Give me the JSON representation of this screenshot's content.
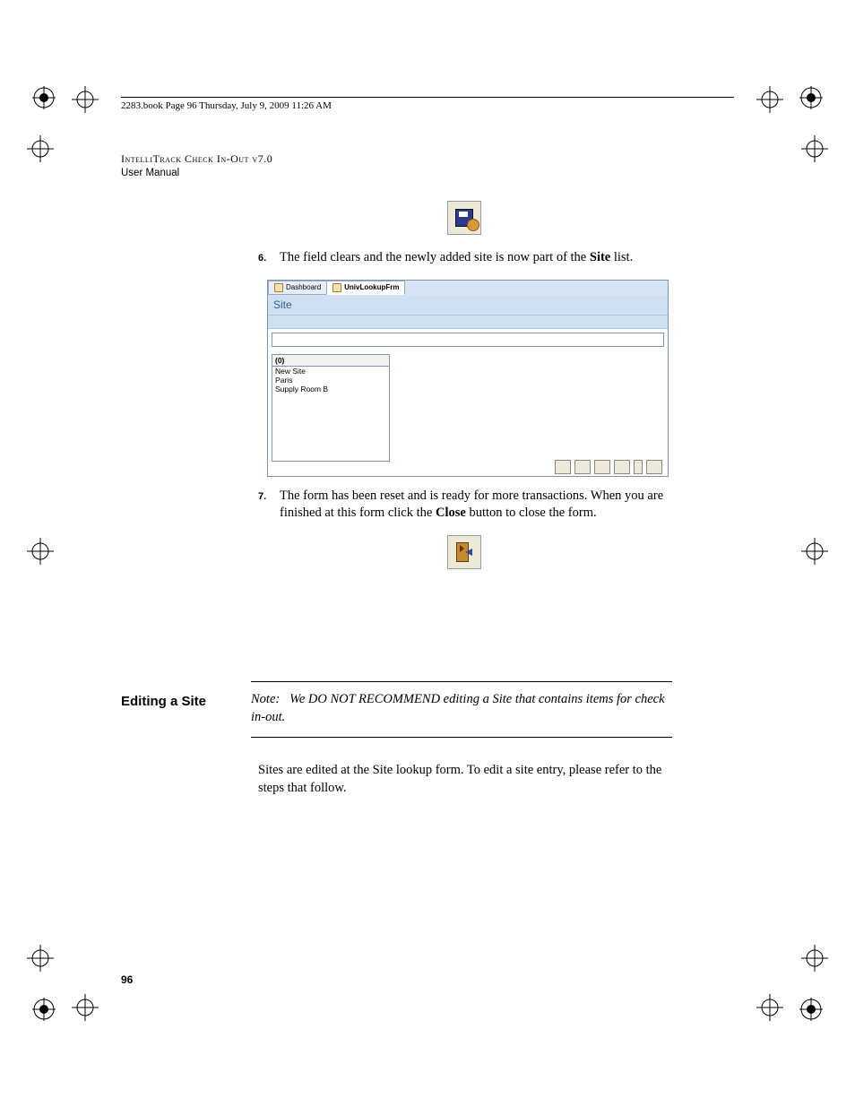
{
  "header": {
    "crop_text": "2283.book  Page 96  Thursday, July 9, 2009  11:26 AM",
    "title_line1": "IntelliTrack Check In-Out v7.0",
    "title_line2": "User Manual"
  },
  "steps": {
    "s6": {
      "num": "6.",
      "text_a": "The field clears and the newly added site is now part of the ",
      "bold": "Site",
      "text_b": " list."
    },
    "s7": {
      "num": "7.",
      "text_a": "The form has been reset and is ready for more transactions. When you are finished at this form click the ",
      "bold": "Close",
      "text_b": " button to close the form."
    }
  },
  "section": {
    "heading": "Editing a Site",
    "note_prefix": "Note:",
    "note_body": "We DO NOT RECOMMEND editing a Site that contains items for check in-out.",
    "paragraph": "Sites are edited at the Site lookup form. To edit a site entry, please refer to the steps that follow."
  },
  "screenshot": {
    "tab1": "Dashboard",
    "tab2": "UnivLookupFrm",
    "form_title": "Site",
    "list_header": "(0)",
    "items": [
      "New Site",
      "Paris",
      "Supply Room B"
    ]
  },
  "page_number": "96"
}
